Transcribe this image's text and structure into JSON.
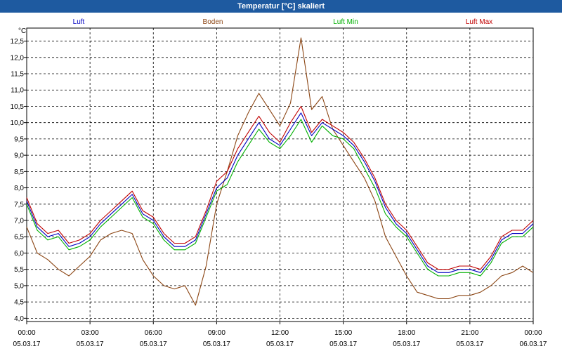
{
  "window": {
    "title": "Temperatur [°C] skaliert"
  },
  "chart_data": {
    "type": "line",
    "title": "Temperatur [°C] skaliert",
    "ylabel": "°C",
    "xlabel": "",
    "ylim": [
      3.9,
      12.9
    ],
    "y_ticks": [
      "4,0",
      "4,5",
      "5,0",
      "5,5",
      "6,0",
      "6,5",
      "7,0",
      "7,5",
      "8,0",
      "8,5",
      "9,0",
      "9,5",
      "10,0",
      "10,5",
      "11,0",
      "11,5",
      "12,0",
      "12,5"
    ],
    "x_ticks": [
      {
        "time": "00:00",
        "date": "05.03.17"
      },
      {
        "time": "03:00",
        "date": "05.03.17"
      },
      {
        "time": "06:00",
        "date": "05.03.17"
      },
      {
        "time": "09:00",
        "date": "05.03.17"
      },
      {
        "time": "12:00",
        "date": "05.03.17"
      },
      {
        "time": "15:00",
        "date": "05.03.17"
      },
      {
        "time": "18:00",
        "date": "05.03.17"
      },
      {
        "time": "21:00",
        "date": "05.03.17"
      },
      {
        "time": "00:00",
        "date": "06.03.17"
      }
    ],
    "grid": true,
    "legend_position": "top",
    "x_hours": [
      0,
      0.5,
      1,
      1.5,
      2,
      2.5,
      3,
      3.5,
      4,
      4.5,
      5,
      5.5,
      6,
      6.5,
      7,
      7.5,
      8,
      8.5,
      9,
      9.5,
      10,
      10.5,
      11,
      11.5,
      12,
      12.5,
      13,
      13.5,
      14,
      14.5,
      15,
      15.5,
      16,
      16.5,
      17,
      17.5,
      18,
      18.5,
      19,
      19.5,
      20,
      20.5,
      21,
      21.5,
      22,
      22.5,
      23,
      23.5,
      24
    ],
    "series": [
      {
        "name": "Luft",
        "color": "#0000c0",
        "values": [
          7.6,
          6.8,
          6.5,
          6.6,
          6.2,
          6.3,
          6.5,
          6.9,
          7.2,
          7.5,
          7.8,
          7.2,
          7.0,
          6.5,
          6.2,
          6.2,
          6.4,
          7.2,
          8.0,
          8.3,
          9.0,
          9.5,
          10.0,
          9.5,
          9.3,
          9.8,
          10.3,
          9.6,
          10.0,
          9.8,
          9.6,
          9.3,
          8.8,
          8.2,
          7.4,
          6.9,
          6.6,
          6.1,
          5.6,
          5.4,
          5.4,
          5.5,
          5.5,
          5.4,
          5.8,
          6.4,
          6.6,
          6.6,
          6.9
        ]
      },
      {
        "name": "Boden",
        "color": "#8b4513",
        "values": [
          6.8,
          6.0,
          5.8,
          5.5,
          5.3,
          5.6,
          5.9,
          6.4,
          6.6,
          6.7,
          6.6,
          5.8,
          5.3,
          5.0,
          4.9,
          5.0,
          4.4,
          5.6,
          7.5,
          8.5,
          9.6,
          10.3,
          10.9,
          10.4,
          9.9,
          10.6,
          12.6,
          10.4,
          10.8,
          9.8,
          9.3,
          8.8,
          8.3,
          7.6,
          6.5,
          5.9,
          5.3,
          4.8,
          4.7,
          4.6,
          4.6,
          4.7,
          4.7,
          4.8,
          5.0,
          5.3,
          5.4,
          5.6,
          5.4
        ]
      },
      {
        "name": "Luft Min",
        "color": "#00b000",
        "values": [
          7.5,
          6.7,
          6.4,
          6.5,
          6.1,
          6.2,
          6.4,
          6.8,
          7.1,
          7.4,
          7.7,
          7.1,
          6.9,
          6.4,
          6.1,
          6.1,
          6.3,
          7.1,
          7.9,
          8.1,
          8.8,
          9.3,
          9.8,
          9.4,
          9.2,
          9.6,
          10.1,
          9.4,
          9.9,
          9.6,
          9.5,
          9.2,
          8.6,
          8.0,
          7.2,
          6.8,
          6.5,
          6.0,
          5.5,
          5.3,
          5.3,
          5.4,
          5.4,
          5.3,
          5.7,
          6.3,
          6.5,
          6.5,
          6.8
        ]
      },
      {
        "name": "Luft Max",
        "color": "#c00000",
        "values": [
          7.7,
          6.9,
          6.6,
          6.7,
          6.3,
          6.4,
          6.6,
          7.0,
          7.3,
          7.6,
          7.9,
          7.3,
          7.1,
          6.6,
          6.3,
          6.3,
          6.5,
          7.3,
          8.2,
          8.5,
          9.2,
          9.7,
          10.2,
          9.7,
          9.4,
          10.0,
          10.5,
          9.7,
          10.1,
          9.9,
          9.7,
          9.4,
          8.9,
          8.3,
          7.5,
          7.0,
          6.7,
          6.2,
          5.7,
          5.5,
          5.5,
          5.6,
          5.6,
          5.5,
          5.9,
          6.5,
          6.7,
          6.7,
          7.0
        ]
      }
    ]
  }
}
